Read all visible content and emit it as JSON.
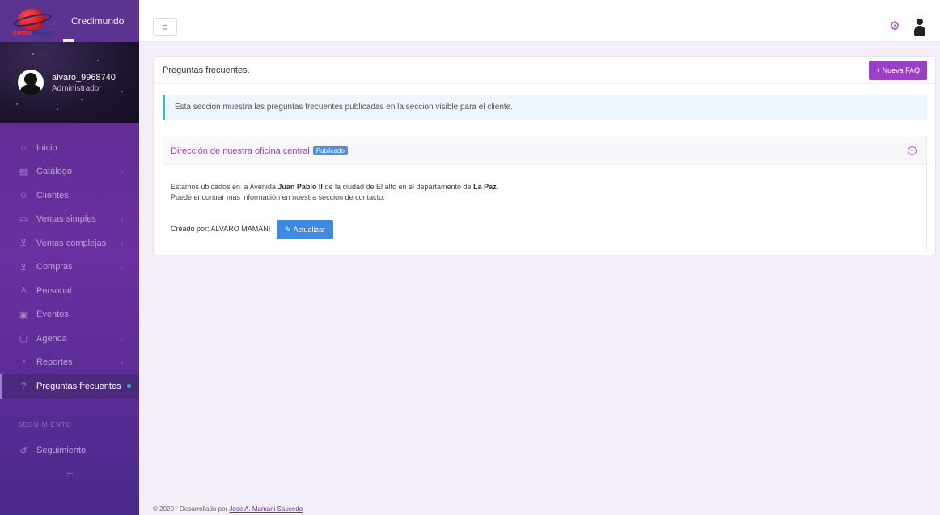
{
  "brand": {
    "name": "Credimundo",
    "logo_text_a": "CREDI",
    "logo_text_b": "MUNDO"
  },
  "user": {
    "name": "alvaro_9968740",
    "role": "Administrador"
  },
  "menu": {
    "items": [
      {
        "label": "Inicio",
        "icon": "home-icon",
        "glyph": "⌂",
        "has_arrow": false
      },
      {
        "label": "Catálogo",
        "icon": "catalog-icon",
        "glyph": "▤",
        "has_arrow": true
      },
      {
        "label": "Clientes",
        "icon": "users-icon",
        "glyph": "☺",
        "has_arrow": false
      },
      {
        "label": "Ventas simples",
        "icon": "sales-icon",
        "glyph": "⛀",
        "has_arrow": true
      },
      {
        "label": "Ventas complejas",
        "icon": "cart-icon",
        "glyph": "⊻",
        "has_arrow": true
      },
      {
        "label": "Compras",
        "icon": "purchases-icon",
        "glyph": "⊻",
        "has_arrow": true
      },
      {
        "label": "Personal",
        "icon": "person-icon",
        "glyph": "♙",
        "has_arrow": false
      },
      {
        "label": "Eventos",
        "icon": "events-icon",
        "glyph": "▣",
        "has_arrow": false
      },
      {
        "label": "Agenda",
        "icon": "calendar-icon",
        "glyph": "▢",
        "has_arrow": true
      },
      {
        "label": "Reportes",
        "icon": "reports-icon",
        "glyph": "◔",
        "has_arrow": true
      },
      {
        "label": "Preguntas frecuentes",
        "icon": "faq-icon",
        "glyph": "?",
        "has_arrow": false,
        "active": true
      }
    ],
    "section_label": "SEGUIMIENTO",
    "tracking_item": {
      "label": "Seguimiento",
      "icon": "tracking-icon",
      "glyph": "↺"
    }
  },
  "topbar": {
    "menu_toggle": "≡"
  },
  "card": {
    "title": "Preguntas frecuentes.",
    "new_button": "+ Nueva FAQ",
    "info": "Esta seccion muestra las preguntas frecuentes publicadas en la seccion visible para el cliente."
  },
  "faq": {
    "title": "Dirección de nuestra oficina central",
    "status": "Publicado",
    "line1_a": "Estamos ubicados en la Avenida ",
    "line1_b": "Juan Pablo II",
    "line1_c": " de la ciudad de El alto en el departamento de ",
    "line1_d": "La Paz.",
    "line2": "Puede encontrar mas información en nuestra sección de contacto.",
    "created_by": "Creado por: ALVARO MAMANI",
    "update_button": "Actualizar"
  },
  "footer": {
    "text": "© 2020 - Desarrollado por ",
    "author": "Jose A. Mamani Saucedo"
  },
  "colors": {
    "accent": "#9b3fc4",
    "primary": "#3d8ae0",
    "sidebar": "#5a2d8c",
    "info_border": "#3bc0c8"
  }
}
